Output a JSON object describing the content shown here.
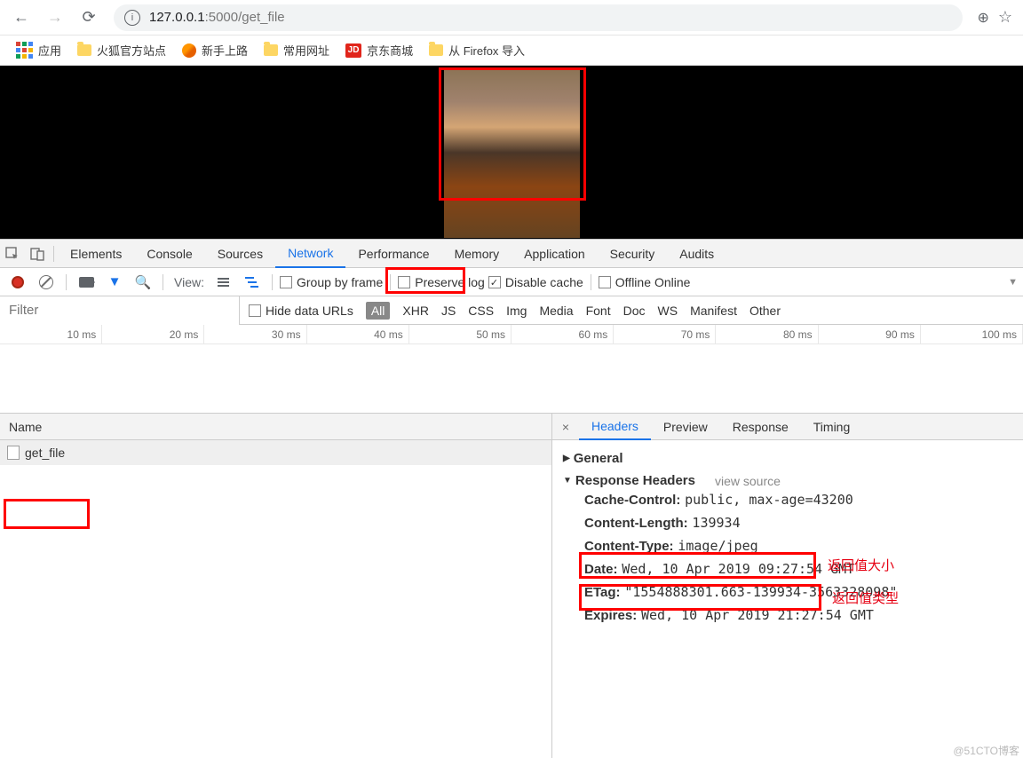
{
  "nav": {
    "url_host": "127.0.0.1",
    "url_port": ":5000",
    "url_path": "/get_file"
  },
  "bookmarks": {
    "apps": "应用",
    "items": [
      "火狐官方站点",
      "新手上路",
      "常用网址",
      "京东商城",
      "从 Firefox 导入"
    ],
    "jd": "JD"
  },
  "devtools": {
    "tabs": [
      "Elements",
      "Console",
      "Sources",
      "Network",
      "Performance",
      "Memory",
      "Application",
      "Security",
      "Audits"
    ],
    "active_tab": "Network"
  },
  "net_toolbar": {
    "view": "View:",
    "group": "Group by frame",
    "preserve": "Preserve log",
    "disable": "Disable cache",
    "offline": "Offline",
    "online": "Online"
  },
  "filter": {
    "placeholder": "Filter",
    "hide": "Hide data URLs",
    "types": [
      "All",
      "XHR",
      "JS",
      "CSS",
      "Img",
      "Media",
      "Font",
      "Doc",
      "WS",
      "Manifest",
      "Other"
    ]
  },
  "timeline": [
    "10 ms",
    "20 ms",
    "30 ms",
    "40 ms",
    "50 ms",
    "60 ms",
    "70 ms",
    "80 ms",
    "90 ms",
    "100 ms"
  ],
  "requests": {
    "name_header": "Name",
    "items": [
      "get_file"
    ]
  },
  "details": {
    "tabs": [
      "Headers",
      "Preview",
      "Response",
      "Timing"
    ],
    "general": "General",
    "resp_headers": "Response Headers",
    "view_source": "view source",
    "headers": [
      {
        "k": "Cache-Control:",
        "v": "public, max-age=43200"
      },
      {
        "k": "Content-Length:",
        "v": "139934"
      },
      {
        "k": "Content-Type:",
        "v": "image/jpeg"
      },
      {
        "k": "Date:",
        "v": "Wed, 10 Apr 2019 09:27:54 GMT"
      },
      {
        "k": "ETag:",
        "v": "\"1554888301.663-139934-3563328098\""
      },
      {
        "k": "Expires:",
        "v": "Wed, 10 Apr 2019 21:27:54 GMT"
      }
    ]
  },
  "annotation": {
    "size": "返回值大小",
    "type": "返回值类型"
  },
  "watermark": "@51CTO博客"
}
